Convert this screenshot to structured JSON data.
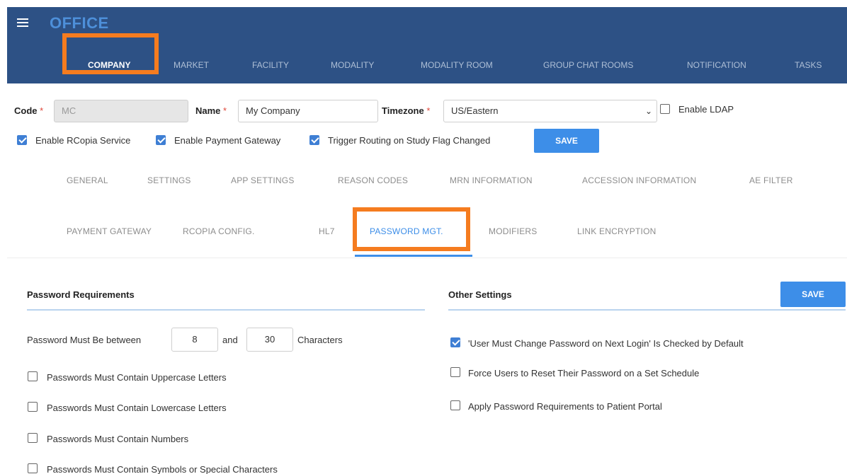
{
  "header": {
    "app_title": "OFFICE",
    "nav": [
      {
        "label": "COMPANY",
        "active": true
      },
      {
        "label": "MARKET"
      },
      {
        "label": "FACILITY"
      },
      {
        "label": "MODALITY"
      },
      {
        "label": "MODALITY ROOM"
      },
      {
        "label": "GROUP CHAT ROOMS"
      },
      {
        "label": "NOTIFICATION"
      },
      {
        "label": "TASKS"
      }
    ]
  },
  "company_form": {
    "code_label": "Code",
    "code_value": "MC",
    "name_label": "Name",
    "name_value": "My Company",
    "timezone_label": "Timezone",
    "timezone_value": "US/Eastern",
    "required_mark": "*",
    "enable_ldap": {
      "label": "Enable LDAP",
      "checked": false
    },
    "enable_rcopia": {
      "label": "Enable RCopia Service",
      "checked": true
    },
    "enable_payment": {
      "label": "Enable Payment Gateway",
      "checked": true
    },
    "trigger_routing": {
      "label": "Trigger Routing on Study Flag Changed",
      "checked": true
    },
    "save_label": "SAVE"
  },
  "subtabs_row1": [
    "GENERAL",
    "SETTINGS",
    "APP SETTINGS",
    "REASON CODES",
    "MRN INFORMATION",
    "ACCESSION INFORMATION",
    "AE FILTER"
  ],
  "subtabs_row2": [
    "PAYMENT GATEWAY",
    "RCOPIA CONFIG.",
    "HL7",
    "PASSWORD MGT.",
    "MODIFIERS",
    "LINK ENCRYPTION"
  ],
  "password_requirements": {
    "title": "Password Requirements",
    "length_prefix": "Password Must Be between",
    "min_value": "8",
    "and_label": "and",
    "max_value": "30",
    "length_suffix": "Characters",
    "options": [
      {
        "label": "Passwords Must Contain Uppercase Letters",
        "checked": false
      },
      {
        "label": "Passwords Must Contain Lowercase Letters",
        "checked": false
      },
      {
        "label": "Passwords Must Contain Numbers",
        "checked": false
      },
      {
        "label": "Passwords Must Contain Symbols or Special Characters",
        "checked": false
      }
    ]
  },
  "other_settings": {
    "title": "Other Settings",
    "save_label": "SAVE",
    "options": [
      {
        "label": "'User Must Change Password on Next Login' Is Checked by Default",
        "checked": true
      },
      {
        "label": "Force Users to Reset Their Password on a Set Schedule",
        "checked": false
      },
      {
        "label": "Apply Password Requirements to Patient Portal",
        "checked": false
      }
    ]
  },
  "colors": {
    "header_bg": "#2d5185",
    "accent": "#3d8ee8",
    "highlight": "#f57c1f"
  }
}
